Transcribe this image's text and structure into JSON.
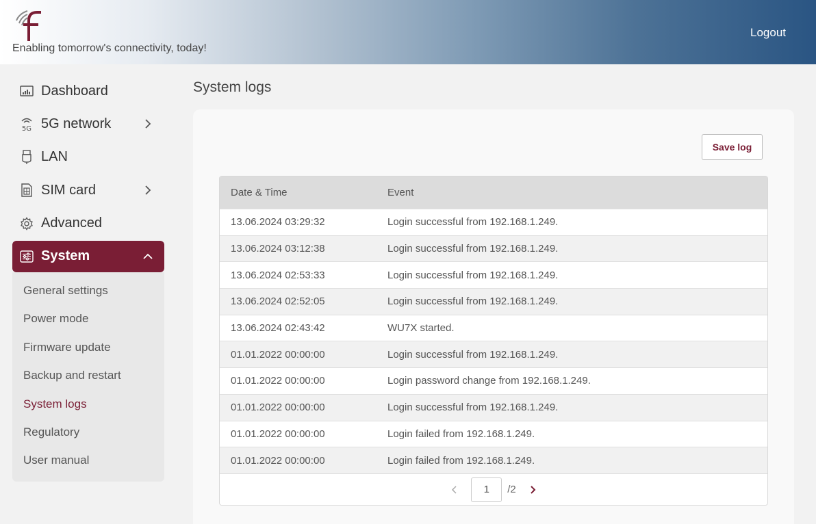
{
  "header": {
    "tagline": "Enabling tomorrow's connectivity, today!",
    "logout_label": "Logout"
  },
  "sidebar": {
    "items": [
      {
        "label": "Dashboard",
        "icon": "dashboard-icon"
      },
      {
        "label": "5G network",
        "icon": "5g-icon"
      },
      {
        "label": "LAN",
        "icon": "ethernet-plug-icon"
      },
      {
        "label": "SIM card",
        "icon": "sim-card-icon"
      },
      {
        "label": "Advanced",
        "icon": "gear-icon"
      },
      {
        "label": "System",
        "icon": "sliders-icon"
      }
    ],
    "system_subitems": [
      "General settings",
      "Power mode",
      "Firmware update",
      "Backup and restart",
      "System logs",
      "Regulatory",
      "User manual"
    ]
  },
  "main": {
    "title": "System logs",
    "save_label": "Save log",
    "table": {
      "columns": [
        "Date & Time",
        "Event"
      ],
      "rows": [
        [
          "13.06.2024 03:29:32",
          "Login successful from 192.168.1.249."
        ],
        [
          "13.06.2024 03:12:38",
          "Login successful from 192.168.1.249."
        ],
        [
          "13.06.2024 02:53:33",
          "Login successful from 192.168.1.249."
        ],
        [
          "13.06.2024 02:52:05",
          "Login successful from 192.168.1.249."
        ],
        [
          "13.06.2024 02:43:42",
          "WU7X started."
        ],
        [
          "01.01.2022 00:00:00",
          "Login successful from 192.168.1.249."
        ],
        [
          "01.01.2022 00:00:00",
          "Login password change from 192.168.1.249."
        ],
        [
          "01.01.2022 00:00:00",
          "Login successful from 192.168.1.249."
        ],
        [
          "01.01.2022 00:00:00",
          "Login failed from 192.168.1.249."
        ],
        [
          "01.01.2022 00:00:00",
          "Login failed from 192.168.1.249."
        ]
      ]
    },
    "pager": {
      "current": "1",
      "total": "/2"
    }
  },
  "colors": {
    "accent": "#7a1e35",
    "header_dark": "#2a5583"
  }
}
